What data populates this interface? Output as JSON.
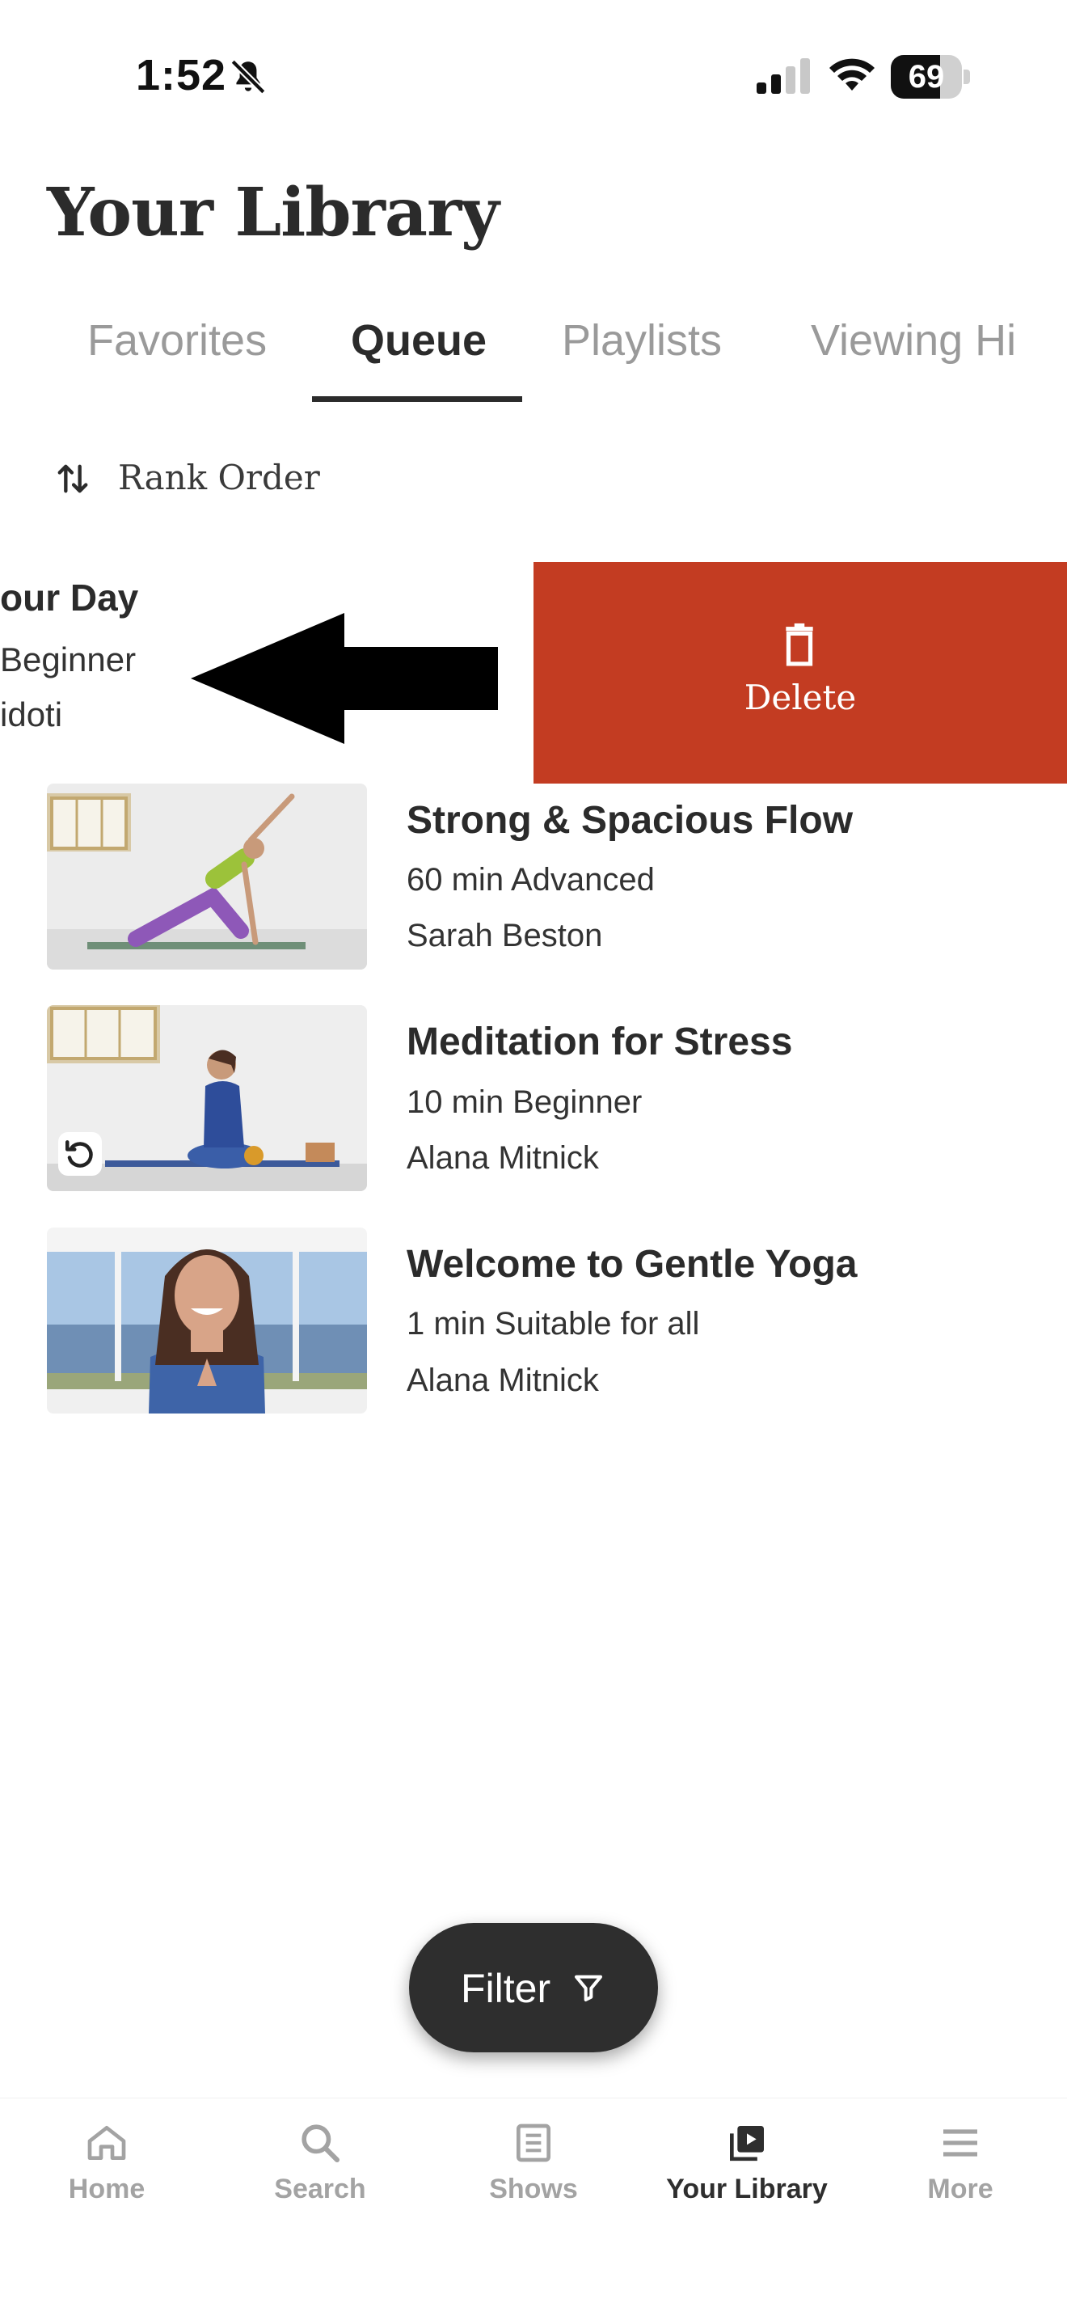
{
  "status_bar": {
    "time": "1:52",
    "battery": "69",
    "battery_level": 0.69
  },
  "title": "Your Library",
  "tabs": [
    {
      "label": "Favorites",
      "active": false
    },
    {
      "label": "Queue",
      "active": true
    },
    {
      "label": "Playlists",
      "active": false
    },
    {
      "label": "Viewing Hi",
      "active": false
    }
  ],
  "sort": {
    "label": "Rank Order"
  },
  "swiped_item": {
    "title": "our Day",
    "meta": "Beginner",
    "instructor": "idoti",
    "delete_label": "Delete"
  },
  "items": [
    {
      "title": "Strong & Spacious Flow",
      "meta": "60 min  Advanced",
      "instructor": "Sarah Beston"
    },
    {
      "title": "Meditation for Stress",
      "meta": "10 min  Beginner",
      "instructor": "Alana Mitnick"
    },
    {
      "title": "Welcome to Gentle Yoga",
      "meta": "1 min  Suitable for all",
      "instructor": "Alana Mitnick"
    }
  ],
  "filter": {
    "label": "Filter"
  },
  "nav": [
    {
      "label": "Home",
      "icon": "home-icon",
      "active": false
    },
    {
      "label": "Search",
      "icon": "search-icon",
      "active": false
    },
    {
      "label": "Shows",
      "icon": "shows-icon",
      "active": false
    },
    {
      "label": "Your Library",
      "icon": "library-icon",
      "active": true
    },
    {
      "label": "More",
      "icon": "menu-icon",
      "active": false
    }
  ],
  "colors": {
    "delete": "#c33c22",
    "active_text": "#2b2b2b",
    "inactive_text": "#9a9a9a"
  }
}
